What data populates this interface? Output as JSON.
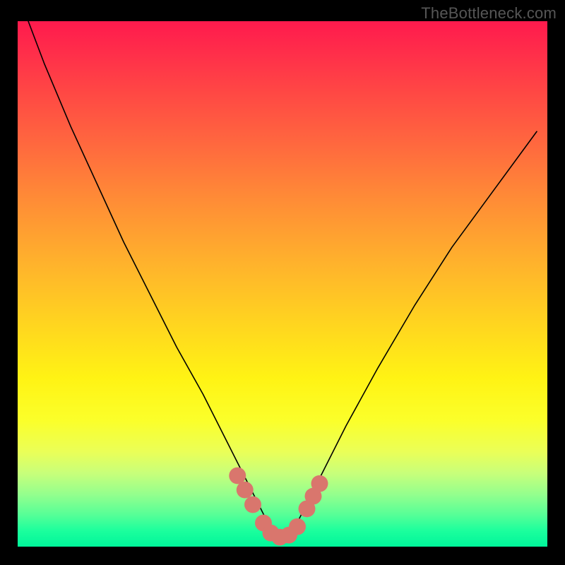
{
  "watermark": {
    "text": "TheBottleneck.com"
  },
  "chart_data": {
    "type": "line",
    "title": "",
    "xlabel": "",
    "ylabel": "",
    "xlim": [
      0,
      100
    ],
    "ylim": [
      0,
      100
    ],
    "grid": false,
    "legend": false,
    "annotations": [],
    "series": [
      {
        "name": "bottleneck-curve",
        "color": "#000000",
        "x": [
          2,
          5,
          10,
          15,
          20,
          25,
          30,
          35,
          40,
          42,
          44,
          46,
          47,
          48,
          49,
          50,
          51,
          52,
          53,
          55,
          58,
          62,
          68,
          75,
          82,
          90,
          98
        ],
        "y": [
          100,
          92,
          80,
          69,
          58,
          48,
          38,
          29,
          19,
          15,
          11,
          7,
          5,
          3.5,
          2.5,
          2,
          2.5,
          3.5,
          5,
          9,
          15,
          23,
          34,
          46,
          57,
          68,
          79
        ]
      }
    ],
    "markers": [
      {
        "name": "highlight-dot",
        "color": "#d9766d",
        "x": 41.5,
        "y": 13.5,
        "r": 1.6
      },
      {
        "name": "highlight-dot",
        "color": "#d9766d",
        "x": 42.9,
        "y": 10.8,
        "r": 1.6
      },
      {
        "name": "highlight-dot",
        "color": "#d9766d",
        "x": 44.4,
        "y": 8.0,
        "r": 1.6
      },
      {
        "name": "highlight-dot",
        "color": "#d9766d",
        "x": 46.4,
        "y": 4.5,
        "r": 1.6
      },
      {
        "name": "highlight-dot",
        "color": "#d9766d",
        "x": 47.8,
        "y": 2.6,
        "r": 1.6
      },
      {
        "name": "highlight-dot",
        "color": "#d9766d",
        "x": 49.5,
        "y": 1.8,
        "r": 1.6
      },
      {
        "name": "highlight-dot",
        "color": "#d9766d",
        "x": 51.2,
        "y": 2.2,
        "r": 1.6
      },
      {
        "name": "highlight-dot",
        "color": "#d9766d",
        "x": 52.8,
        "y": 3.8,
        "r": 1.6
      },
      {
        "name": "highlight-dot",
        "color": "#d9766d",
        "x": 54.6,
        "y": 7.2,
        "r": 1.6
      },
      {
        "name": "highlight-dot",
        "color": "#d9766d",
        "x": 55.8,
        "y": 9.6,
        "r": 1.6
      },
      {
        "name": "highlight-dot",
        "color": "#d9766d",
        "x": 57.0,
        "y": 12.0,
        "r": 1.6
      }
    ],
    "background": {
      "type": "vertical-gradient",
      "stops": [
        {
          "pos": 0,
          "color": "#ff1a4d"
        },
        {
          "pos": 50,
          "color": "#ffc61f"
        },
        {
          "pos": 75,
          "color": "#fbff2a"
        },
        {
          "pos": 100,
          "color": "#00f59a"
        }
      ]
    }
  }
}
